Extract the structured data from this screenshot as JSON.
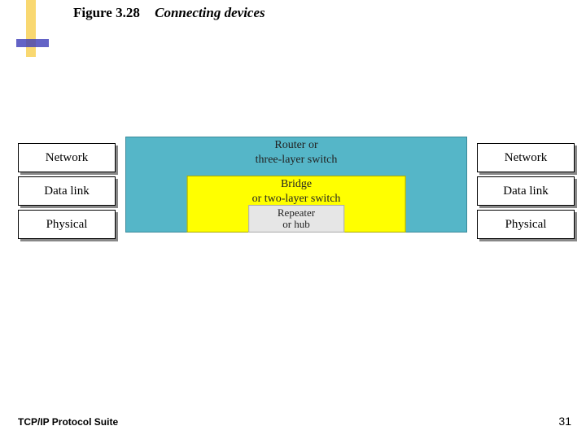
{
  "figure": {
    "number": "Figure 3.28",
    "caption": "Connecting devices"
  },
  "left_stack": {
    "layers": [
      "Network",
      "Data link",
      "Physical"
    ]
  },
  "right_stack": {
    "layers": [
      "Network",
      "Data link",
      "Physical"
    ]
  },
  "devices": {
    "router": {
      "line1": "Router or",
      "line2": "three-layer switch"
    },
    "bridge": {
      "line1": "Bridge",
      "line2": "or two-layer switch"
    },
    "repeater": {
      "line1": "Repeater",
      "line2": "or hub"
    }
  },
  "footer": {
    "left": "TCP/IP Protocol Suite",
    "page": "31"
  }
}
